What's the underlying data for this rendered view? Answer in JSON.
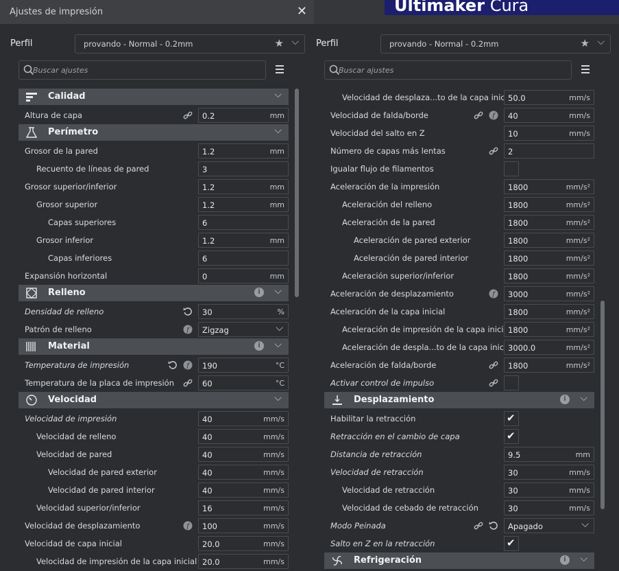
{
  "window": {
    "title": "Ajustes de impresión",
    "brand_bold": "Ultimaker",
    "brand_light": "Cura"
  },
  "profile": {
    "label": "Perfil",
    "value": "provando - Normal - 0.2mm"
  },
  "search": {
    "placeholder": "Buscar ajustes"
  },
  "left_rows": [
    {
      "type": "cat",
      "name": "Calidad",
      "icon": "quality-icon"
    },
    {
      "type": "row",
      "label": "Altura de capa",
      "value": "0.2",
      "unit": "mm",
      "indent": 0,
      "icons": [
        "link-icon"
      ]
    },
    {
      "type": "cat",
      "name": "Perímetro",
      "icon": "shell-icon"
    },
    {
      "type": "row",
      "label": "Grosor de la pared",
      "value": "1.2",
      "unit": "mm",
      "indent": 0
    },
    {
      "type": "row",
      "label": "Recuento de líneas de pared",
      "value": "3",
      "unit": "",
      "indent": 1
    },
    {
      "type": "row",
      "label": "Grosor superior/inferior",
      "value": "1.2",
      "unit": "mm",
      "indent": 0
    },
    {
      "type": "row",
      "label": "Grosor superior",
      "value": "1.2",
      "unit": "mm",
      "indent": 1
    },
    {
      "type": "row",
      "label": "Capas superiores",
      "value": "6",
      "unit": "",
      "indent": 2
    },
    {
      "type": "row",
      "label": "Grosor inferior",
      "value": "1.2",
      "unit": "mm",
      "indent": 1
    },
    {
      "type": "row",
      "label": "Capas inferiores",
      "value": "6",
      "unit": "",
      "indent": 2
    },
    {
      "type": "row",
      "label": "Expansión horizontal",
      "value": "0",
      "unit": "mm",
      "indent": 0
    },
    {
      "type": "cat",
      "name": "Relleno",
      "icon": "infill-icon",
      "info": true
    },
    {
      "type": "row",
      "label": "Densidad de relleno",
      "value": "30",
      "unit": "%",
      "indent": 0,
      "italic": true,
      "icons": [
        "reset-icon"
      ]
    },
    {
      "type": "row",
      "label": "Patrón de relleno",
      "value": "Zigzag",
      "unit": "",
      "indent": 0,
      "dropdown": true,
      "icons": [
        "function-icon"
      ]
    },
    {
      "type": "cat",
      "name": "Material",
      "icon": "material-icon",
      "info": true
    },
    {
      "type": "row",
      "label": "Temperatura de impresión",
      "value": "190",
      "unit": "°C",
      "indent": 0,
      "italic": true,
      "icons": [
        "reset-icon",
        "function-icon"
      ]
    },
    {
      "type": "row",
      "label": "Temperatura de la placa de impresión",
      "value": "60",
      "unit": "°C",
      "indent": 0,
      "icons": [
        "link-icon"
      ]
    },
    {
      "type": "cat",
      "name": "Velocidad",
      "icon": "speed-icon"
    },
    {
      "type": "row",
      "label": "Velocidad de impresión",
      "value": "40",
      "unit": "mm/s",
      "indent": 0,
      "italic": true
    },
    {
      "type": "row",
      "label": "Velocidad de relleno",
      "value": "40",
      "unit": "mm/s",
      "indent": 1
    },
    {
      "type": "row",
      "label": "Velocidad de pared",
      "value": "40",
      "unit": "mm/s",
      "indent": 1
    },
    {
      "type": "row",
      "label": "Velocidad de pared exterior",
      "value": "40",
      "unit": "mm/s",
      "indent": 2
    },
    {
      "type": "row",
      "label": "Velocidad de pared interior",
      "value": "40",
      "unit": "mm/s",
      "indent": 2
    },
    {
      "type": "row",
      "label": "Velocidad superior/inferior",
      "value": "16",
      "unit": "mm/s",
      "indent": 1
    },
    {
      "type": "row",
      "label": "Velocidad de desplazamiento",
      "value": "100",
      "unit": "mm/s",
      "indent": 0,
      "icons": [
        "function-icon"
      ]
    },
    {
      "type": "row",
      "label": "Velocidad de capa inicial",
      "value": "20.0",
      "unit": "mm/s",
      "indent": 0
    },
    {
      "type": "row",
      "label": "Velocidad de impresión de la capa inicial",
      "value": "20.0",
      "unit": "mm/s",
      "indent": 1
    }
  ],
  "right_rows": [
    {
      "type": "row",
      "label": "Velocidad de desplaza...to de la capa inicial",
      "value": "50.0",
      "unit": "mm/s",
      "indent": 1
    },
    {
      "type": "row",
      "label": "Velocidad de falda/borde",
      "value": "40",
      "unit": "mm/s",
      "indent": 0,
      "icons": [
        "link-icon",
        "function-icon"
      ]
    },
    {
      "type": "row",
      "label": "Velocidad del salto en Z",
      "value": "10",
      "unit": "mm/s",
      "indent": 0
    },
    {
      "type": "row",
      "label": "Número de capas más lentas",
      "value": "2",
      "unit": "",
      "indent": 0,
      "icons": [
        "link-icon"
      ]
    },
    {
      "type": "check",
      "label": "Igualar flujo de filamentos",
      "checked": false,
      "indent": 0
    },
    {
      "type": "row",
      "label": "Aceleración de la impresión",
      "value": "1800",
      "unit": "mm/s²",
      "indent": 0
    },
    {
      "type": "row",
      "label": "Aceleración del relleno",
      "value": "1800",
      "unit": "mm/s²",
      "indent": 1
    },
    {
      "type": "row",
      "label": "Aceleración de la pared",
      "value": "1800",
      "unit": "mm/s²",
      "indent": 1
    },
    {
      "type": "row",
      "label": "Aceleración de pared exterior",
      "value": "1800",
      "unit": "mm/s²",
      "indent": 2
    },
    {
      "type": "row",
      "label": "Aceleración de pared interior",
      "value": "1800",
      "unit": "mm/s²",
      "indent": 2
    },
    {
      "type": "row",
      "label": "Aceleración superior/inferior",
      "value": "1800",
      "unit": "mm/s²",
      "indent": 1
    },
    {
      "type": "row",
      "label": "Aceleración de desplazamiento",
      "value": "3000",
      "unit": "mm/s²",
      "indent": 0,
      "icons": [
        "function-icon"
      ]
    },
    {
      "type": "row",
      "label": "Aceleración de la capa inicial",
      "value": "1800",
      "unit": "mm/s²",
      "indent": 0
    },
    {
      "type": "row",
      "label": "Aceleración de impresión de la capa inicial",
      "value": "1800",
      "unit": "mm/s²",
      "indent": 1
    },
    {
      "type": "row",
      "label": "Aceleración de despla...to de la capa inicial",
      "value": "3000.0",
      "unit": "mm/s²",
      "indent": 1
    },
    {
      "type": "row",
      "label": "Aceleración de falda/borde",
      "value": "1800",
      "unit": "mm/s²",
      "indent": 0,
      "icons": [
        "link-icon"
      ]
    },
    {
      "type": "check",
      "label": "Activar control de impulso",
      "checked": false,
      "indent": 0,
      "italic": true,
      "icons": [
        "link-icon"
      ]
    },
    {
      "type": "cat",
      "name": "Desplazamiento",
      "icon": "travel-icon",
      "info": true
    },
    {
      "type": "check",
      "label": "Habilitar la retracción",
      "checked": true,
      "indent": 0
    },
    {
      "type": "check",
      "label": "Retracción en el cambio de capa",
      "checked": true,
      "indent": 0,
      "italic": true
    },
    {
      "type": "row",
      "label": "Distancia de retracción",
      "value": "9.5",
      "unit": "mm",
      "indent": 0,
      "italic": true
    },
    {
      "type": "row",
      "label": "Velocidad de retracción",
      "value": "30",
      "unit": "mm/s",
      "indent": 0,
      "italic": true
    },
    {
      "type": "row",
      "label": "Velocidad de retracción",
      "value": "30",
      "unit": "mm/s",
      "indent": 1
    },
    {
      "type": "row",
      "label": "Velocidad de cebado de retracción",
      "value": "30",
      "unit": "mm/s",
      "indent": 1
    },
    {
      "type": "row",
      "label": "Modo Peinada",
      "value": "Apagado",
      "unit": "",
      "indent": 0,
      "italic": true,
      "dropdown": true,
      "icons": [
        "link-icon",
        "reset-icon"
      ]
    },
    {
      "type": "check",
      "label": "Salto en Z en la retracción",
      "checked": true,
      "indent": 0,
      "italic": true
    },
    {
      "type": "cat",
      "name": "Refrigeración",
      "icon": "cooling-icon",
      "info": true
    }
  ]
}
